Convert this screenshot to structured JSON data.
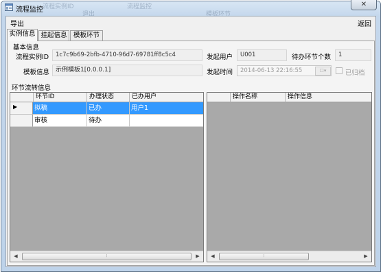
{
  "window": {
    "title": "流程监控",
    "close_glyph": "✕",
    "background_ghost": [
      "流程实例ID",
      "退出",
      "流程监控",
      "模板环节"
    ]
  },
  "toolbar": {
    "export_label": "导出",
    "back_label": "返回"
  },
  "tabs": [
    {
      "label": "实例信息",
      "active": true
    },
    {
      "label": "挂起信息",
      "active": false
    },
    {
      "label": "模板环节",
      "active": false
    }
  ],
  "basic_info": {
    "section_title": "基本信息",
    "instance_id_label": "流程实例ID",
    "instance_id_value": "1c7c9b69-2bfb-4710-96d7-69781ff8c5c4",
    "initiator_label": "发起用户",
    "initiator_value": "U001",
    "pending_count_label": "待办环节个数",
    "pending_count_value": "1",
    "template_label": "模板信息",
    "template_value": "示例模板1[0.0.0.1]",
    "start_time_label": "发起时间",
    "start_time_value": "2014-06-13 22:16:55",
    "archived_label": "已归档"
  },
  "flow_section_title": "环节流转信息",
  "steps_table": {
    "columns": [
      "环节ID",
      "办理状态",
      "已办用户"
    ],
    "rows": [
      [
        "拟稿",
        "已办",
        "用户1"
      ],
      [
        "审核",
        "待办",
        ""
      ]
    ],
    "row_indicator": "▶"
  },
  "operations_table": {
    "columns": [
      "操作名称",
      "操作信息"
    ],
    "rows": []
  },
  "colors": {
    "selection": "#3399ff",
    "grid_empty": "#a9a9a9"
  },
  "scroll_glyphs": {
    "left": "◀",
    "right": "▶",
    "grip": "⦙"
  }
}
